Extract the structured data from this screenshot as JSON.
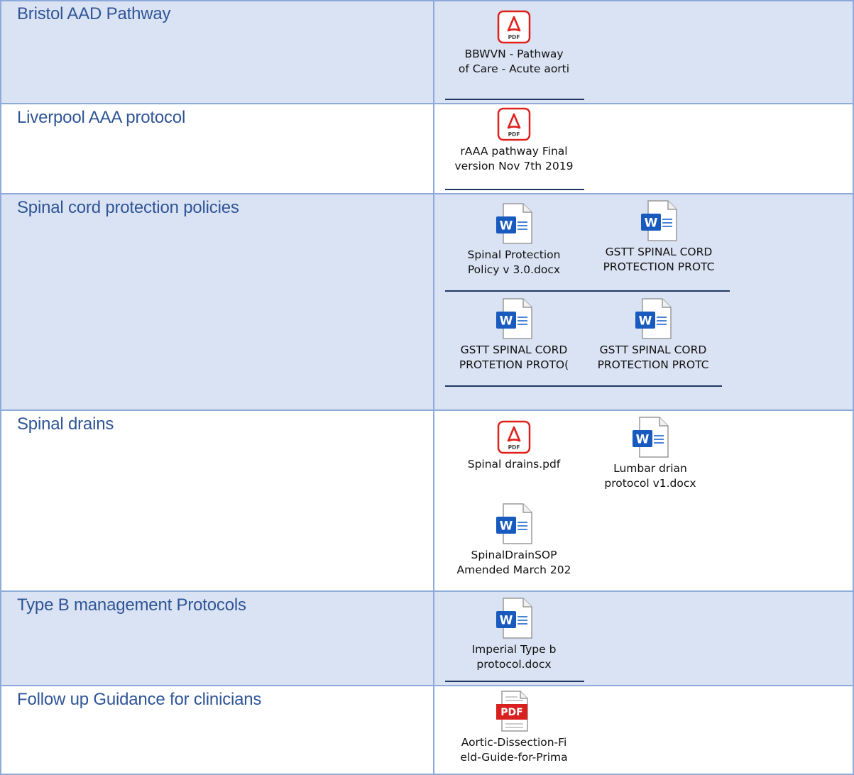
{
  "rows": [
    {
      "label": "Bristol AAD Pathway",
      "files": [
        {
          "icon": "pdf-acrobat-icon",
          "line1": "BBWVN - Pathway",
          "line2": "of Care - Acute aorti"
        }
      ]
    },
    {
      "label": "Liverpool AAA protocol",
      "files": [
        {
          "icon": "pdf-acrobat-icon",
          "line1": "rAAA pathway Final",
          "line2": "version Nov 7th 2019"
        }
      ]
    },
    {
      "label": "Spinal cord protection policies",
      "files": [
        {
          "icon": "word-document-icon",
          "line1": "Spinal Protection",
          "line2": "Policy v 3.0.docx"
        },
        {
          "icon": "word-document-icon",
          "line1": "GSTT SPINAL CORD",
          "line2": "PROTECTION PROTC"
        },
        {
          "icon": "word-document-icon",
          "line1": "GSTT SPINAL CORD",
          "line2": "PROTETION PROTO("
        },
        {
          "icon": "word-document-icon",
          "line1": "GSTT SPINAL CORD",
          "line2": "PROTECTION PROTC"
        }
      ]
    },
    {
      "label": "Spinal drains",
      "files": [
        {
          "icon": "pdf-acrobat-icon",
          "line1": "Spinal drains.pdf",
          "line2": ""
        },
        {
          "icon": "word-document-icon",
          "line1": "Lumbar drian",
          "line2": "protocol v1.docx"
        },
        {
          "icon": "word-document-icon",
          "line1": "SpinalDrainSOP",
          "line2": "Amended March 202"
        }
      ]
    },
    {
      "label": "Type B management Protocols",
      "files": [
        {
          "icon": "word-document-icon",
          "line1": "Imperial Type b",
          "line2": "protocol.docx"
        }
      ]
    },
    {
      "label": "Follow up Guidance for clinicians",
      "files": [
        {
          "icon": "pdf-document-icon",
          "line1": "Aortic-Dissection-Fi",
          "line2": "eld-Guide-for-Prima"
        }
      ]
    }
  ],
  "colors": {
    "shaded_row": "#dae3f3",
    "grid_line": "#8eaadb",
    "label_text": "#2f5597",
    "underline": "#1f3864",
    "pdf_red": "#e0201b",
    "word_blue": "#185abd"
  }
}
